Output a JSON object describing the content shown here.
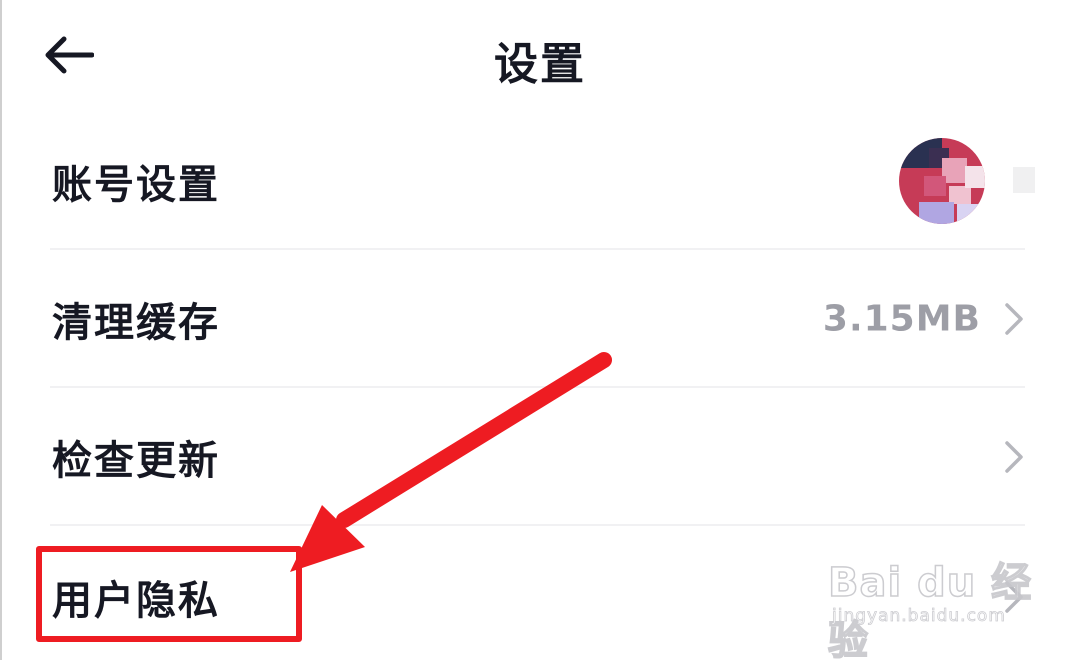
{
  "header": {
    "title": "设置",
    "back_icon": "arrow-left-icon"
  },
  "settings": {
    "items": [
      {
        "label": "账号设置",
        "value": "",
        "trailing": "avatar"
      },
      {
        "label": "清理缓存",
        "value": "3.15MB",
        "trailing": "chevron-right-icon"
      },
      {
        "label": "检查更新",
        "value": "",
        "trailing": "chevron-right-icon"
      },
      {
        "label": "用户隐私",
        "value": "",
        "trailing": "chevron-right-icon"
      }
    ]
  },
  "annotation": {
    "color": "#ee1c22",
    "highlighted_item": "用户隐私"
  },
  "watermark": {
    "main": "Bai du 经验",
    "sub": "jingyan.baidu.com"
  },
  "colors": {
    "text_primary": "#161823",
    "text_secondary": "#9d9ea6",
    "divider": "#f1f1f3",
    "chevron": "#b6b7bd"
  }
}
